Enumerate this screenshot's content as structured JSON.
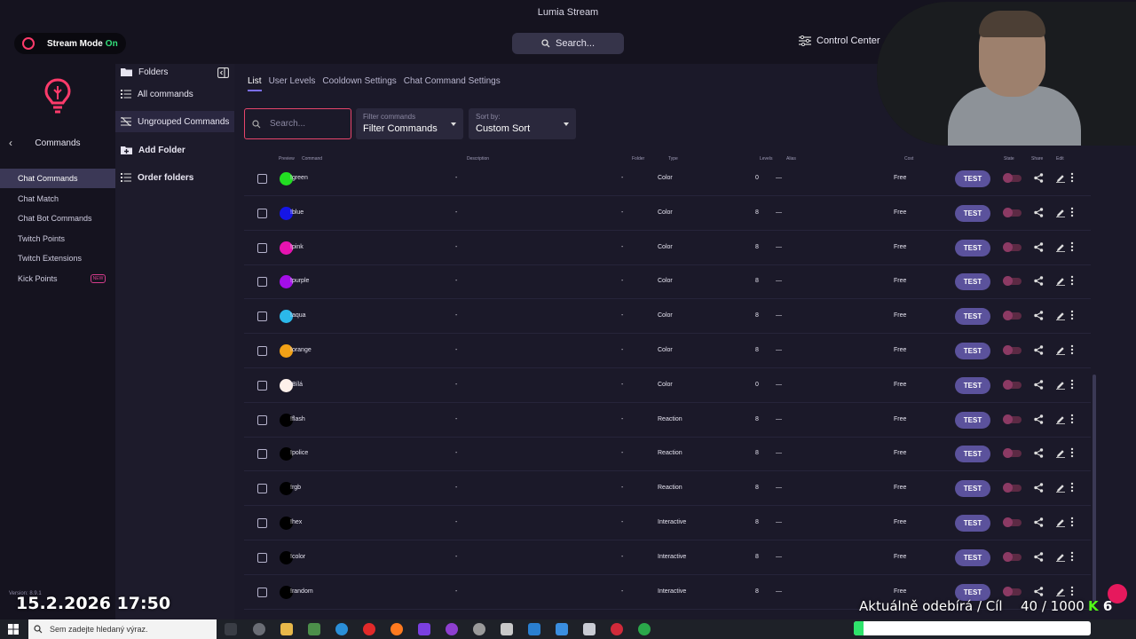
{
  "window": {
    "title": "Lumia Stream"
  },
  "header": {
    "stream_mode_label": "Stream Mode",
    "stream_mode_state": "On",
    "search_label": "Search...",
    "control_center_label": "Control Center"
  },
  "leftnav": {
    "section_title": "Commands",
    "items": [
      {
        "label": "Chat Commands",
        "active": true
      },
      {
        "label": "Chat Match"
      },
      {
        "label": "Chat Bot Commands"
      },
      {
        "label": "Twitch Points"
      },
      {
        "label": "Twitch Extensions"
      },
      {
        "label": "Kick Points",
        "badge": "NEW"
      }
    ],
    "version": "Version: 8.9.1"
  },
  "folders": {
    "title": "Folders",
    "all_label": "All commands",
    "ungrouped_label": "Ungrouped Commands",
    "add_label": "Add Folder",
    "order_label": "Order folders"
  },
  "main": {
    "tabs": [
      "List",
      "User Levels",
      "Cooldown Settings",
      "Chat Command Settings"
    ],
    "search_placeholder": "Search...",
    "filter": {
      "caption": "Filter commands",
      "value": "Filter Commands"
    },
    "sort": {
      "caption": "Sort by:",
      "value": "Custom Sort"
    },
    "columns": {
      "preview": "Preview",
      "command": "Command",
      "description": "Description",
      "folder": "Folder",
      "type": "Type",
      "levels": "Levels",
      "alias": "Alias",
      "cost": "Cost",
      "state": "State",
      "share": "Share",
      "edit": "Edit"
    },
    "test_label": "TEST",
    "rows": [
      {
        "color": "#22dd22",
        "command": "!green",
        "description": "-",
        "folder": "-",
        "type": "Color",
        "levels": "0",
        "alias": "—",
        "cost": "Free"
      },
      {
        "color": "#1515e6",
        "command": "!blue",
        "description": "-",
        "folder": "-",
        "type": "Color",
        "levels": "8",
        "alias": "—",
        "cost": "Free"
      },
      {
        "color": "#e613b0",
        "command": "!pink",
        "description": "-",
        "folder": "-",
        "type": "Color",
        "levels": "8",
        "alias": "—",
        "cost": "Free"
      },
      {
        "color": "#a40ee8",
        "command": "!purple",
        "description": "-",
        "folder": "-",
        "type": "Color",
        "levels": "8",
        "alias": "—",
        "cost": "Free"
      },
      {
        "color": "#2bb8ea",
        "command": "!aqua",
        "description": "-",
        "folder": "-",
        "type": "Color",
        "levels": "8",
        "alias": "—",
        "cost": "Free"
      },
      {
        "color": "#f2a116",
        "command": "!orange",
        "description": "-",
        "folder": "-",
        "type": "Color",
        "levels": "8",
        "alias": "—",
        "cost": "Free"
      },
      {
        "color": "#fdf0ea",
        "command": "!Bílá",
        "description": "-",
        "folder": "-",
        "type": "Color",
        "levels": "0",
        "alias": "—",
        "cost": "Free"
      },
      {
        "color": "#000000",
        "command": "!flash",
        "description": "-",
        "folder": "-",
        "type": "Reaction",
        "levels": "8",
        "alias": "—",
        "cost": "Free"
      },
      {
        "color": "#000000",
        "command": "!police",
        "description": "-",
        "folder": "-",
        "type": "Reaction",
        "levels": "8",
        "alias": "—",
        "cost": "Free"
      },
      {
        "color": "#000000",
        "command": "!rgb",
        "description": "-",
        "folder": "-",
        "type": "Reaction",
        "levels": "8",
        "alias": "—",
        "cost": "Free"
      },
      {
        "color": "#000000",
        "command": "!hex",
        "description": "-",
        "folder": "-",
        "type": "Interactive",
        "levels": "8",
        "alias": "—",
        "cost": "Free"
      },
      {
        "color": "#000000",
        "command": "!color",
        "description": "-",
        "folder": "-",
        "type": "Interactive",
        "levels": "8",
        "alias": "—",
        "cost": "Free"
      },
      {
        "color": "#000000",
        "command": "!random",
        "description": "-",
        "folder": "-",
        "type": "Interactive",
        "levels": "8",
        "alias": "—",
        "cost": "Free"
      }
    ]
  },
  "taskbar": {
    "search_placeholder": "Sem zadejte hledaný výraz."
  },
  "overlay": {
    "datetime": "15.2.2026 17:50",
    "subscribers_label": "Aktuálně odebírá / Cíl",
    "subscribers_count": "40 / 1000",
    "kick_count": "6",
    "goal_fraction": 0.04
  }
}
